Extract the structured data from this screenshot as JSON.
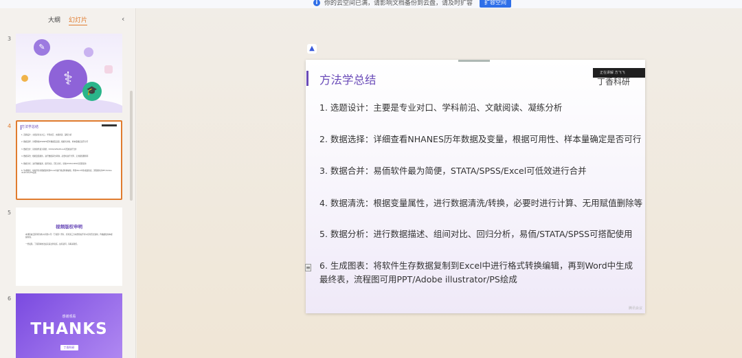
{
  "notice": {
    "icon": "info-icon",
    "text": "你的云空间已满，请影响文档备份到云盘，请及时扩容",
    "button": "扩容空间"
  },
  "sidebar": {
    "tabs": [
      "大纲",
      "幻灯片"
    ],
    "active_tab": "幻灯片",
    "collapse_icon": "chevron-left-icon",
    "slides": [
      {
        "number": "3"
      },
      {
        "number": "4",
        "mini_title": "方法学总结",
        "mini_lines": [
          "1. 选题设计：主要是专业对口、学科前沿、文献阅读、凝练分析",
          "2. 数据选择：详细查看NHANES历年数据及变量，根据可用性、样本量确定是否可行",
          "3. 数据合并：易侕软件最为简便，STATA/SPSS/Excel可低效进行合并",
          "4. 数据清洗：根据变量属性，进行数据清洗/转换，必要时进行计算、无用赋值删除等",
          "5. 数据分析：进行数据描述、组间对比、回归分析，易侕/STATA/SPSS可搭配使用",
          "6. 生成图表：将软件生存数据复制到Excel中进行格式转换编辑，再到Word中生成最终表，流程图可用PPT/Adobe illustrator/PS绘成"
        ]
      },
      {
        "number": "5",
        "title": "视频版权申明",
        "lines": [
          "本课程由云医科研(杭州)有限公司（丁香园）所有，任何第三方未经授权不得以任何形式复制、传播或使用本视频内容。",
          "一经发现，丁香园将依法追究其法律责任。如有疑问，请联系我们。"
        ]
      },
      {
        "number": "6",
        "subtitle": "感谢观看",
        "thanks": "THANKS",
        "chip": "丁香科研"
      }
    ]
  },
  "main": {
    "app_logo": "app-logo-icon",
    "slide": {
      "title": "方法学总结",
      "badge": "正在讲解 方飞飞",
      "brand": "丁香科研",
      "items": [
        "1. 选题设计：主要是专业对口、学科前沿、文献阅读、凝练分析",
        "2. 数据选择：详细查看NHANES历年数据及变量，根据可用性、样本量确定是否可行",
        "3. 数据合并：易侕软件最为简便，STATA/SPSS/Excel可低效进行合并",
        "4. 数据清洗：根据变量属性，进行数据清洗/转换，必要时进行计算、无用赋值删除等",
        "5. 数据分析：进行数据描述、组间对比、回归分析，易侕/STATA/SPSS可搭配使用",
        "6. 生成图表：将软件生存数据复制到Excel中进行格式转换编辑，再到Word中生成最终表，流程图可用PPT/Adobe illustrator/PS绘成"
      ],
      "watermark": "腾讯会议"
    },
    "note_icon": "note-icon"
  },
  "colors": {
    "accent_orange": "#e07b2e",
    "slide_purple": "#6a4bb8",
    "notice_blue": "#2f6fe8"
  }
}
